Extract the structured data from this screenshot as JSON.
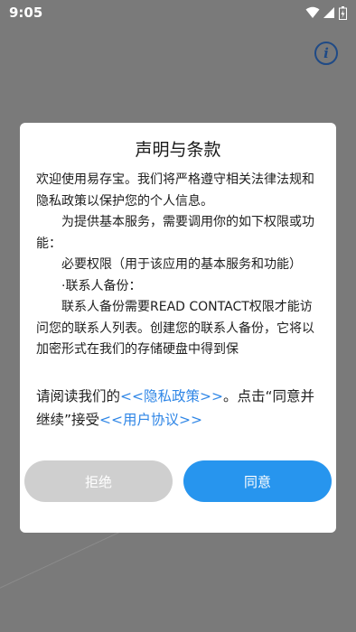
{
  "status_bar": {
    "time": "9:05",
    "icons": [
      "wifi-icon",
      "signal-icon",
      "battery-icon"
    ]
  },
  "colors": {
    "accent": "#2795ee",
    "link": "#2f86e6",
    "reject_button": "#cfcfcf",
    "info_icon": "#1f4a86"
  },
  "dialog": {
    "title": "声明与条款",
    "paragraphs": [
      "欢迎使用易存宝。我们将严格遵守相关法律法规和隐私政策以保护您的个人信息。",
      "为提供基本服务，需要调用你的如下权限或功能：",
      "必要权限（用于该应用的基本服务和功能）",
      "·联系人备份：",
      "联系人备份需要READ CONTACT权限才能访问您的联系人列表。创建您的联系人备份，它将以加密形式在我们的存储硬盘中得到保"
    ],
    "notice_prefix": "请阅读我们的",
    "privacy_link": "<<隐私政策>>",
    "notice_middle": "。点击“同意并继续”接受",
    "agreement_link": "<<用户协议>>",
    "reject_label": "拒绝",
    "agree_label": "同意"
  }
}
